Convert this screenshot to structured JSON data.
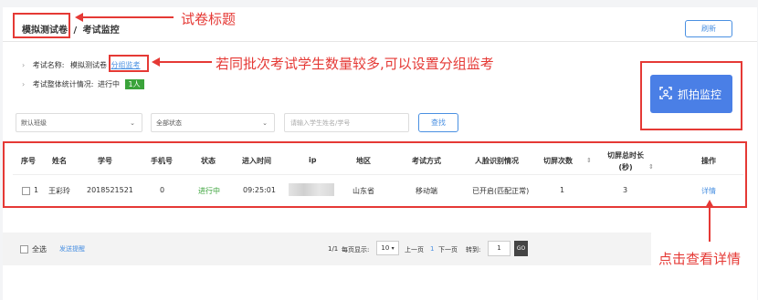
{
  "header": {
    "paper_title": "模拟测试卷",
    "separator": "/",
    "page_title": "考试监控",
    "refresh_label": "刷新"
  },
  "exam_info": {
    "name_label": "考试名称:",
    "name_value": "模拟测试卷",
    "group_link": "分组监考",
    "stats_label": "考试整体统计情况:",
    "stats_status": "进行中",
    "stats_badge": "1人"
  },
  "capture_button": {
    "label": "抓拍监控"
  },
  "filters": {
    "class_select": "默认班级",
    "status_select": "全部状态",
    "search_placeholder": "请输入学生姓名/学号",
    "search_button": "查找"
  },
  "table": {
    "headers": {
      "index": "序号",
      "name": "姓名",
      "student_id": "学号",
      "phone": "手机号",
      "status": "状态",
      "enter_time": "进入时间",
      "ip": "ip",
      "region": "地区",
      "exam_mode": "考试方式",
      "face_recognition": "人脸识别情况",
      "switch_count": "切屏次数",
      "switch_duration_line1": "切屏总时长",
      "switch_duration_line2": "(秒)",
      "action": "操作"
    },
    "rows": [
      {
        "index": "1",
        "name": "王彩玲",
        "student_id": "2018521521",
        "phone": "0",
        "status": "进行中",
        "enter_time": "09:25:01",
        "region": "山东省",
        "exam_mode": "移动端",
        "face_recognition": "已开启(匹配正常)",
        "switch_count": "1",
        "switch_duration": "3",
        "action": "详情"
      }
    ]
  },
  "footer": {
    "select_all": "全选",
    "send_reminder": "发送提醒",
    "page_info": "1/1",
    "per_page_label": "每页显示:",
    "per_page_value": "10",
    "prev_page": "上一页",
    "current_page": "1",
    "next_page": "下一页",
    "goto_label": "转到:",
    "goto_value": "1",
    "go_button": "GO"
  },
  "annotations": {
    "paper_title_note": "试卷标题",
    "group_note": "若同批次考试学生数量较多,可以设置分组监考",
    "detail_note": "点击查看详情"
  },
  "colors": {
    "accent": "#4a90e2",
    "annotation_red": "#e53935",
    "status_green": "#3aa33a",
    "capture_button_bg": "#4a7fe6"
  }
}
